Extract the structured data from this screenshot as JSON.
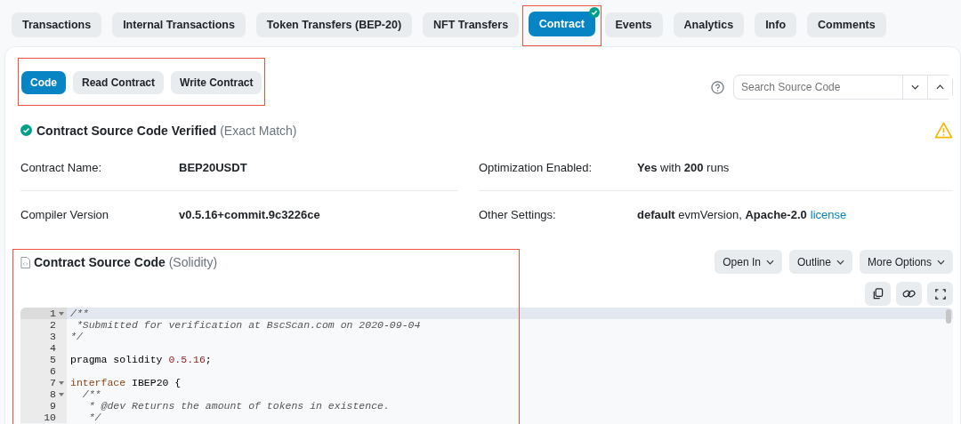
{
  "tabs": [
    {
      "label": "Transactions",
      "selected": false,
      "verified": false,
      "highlighted": false
    },
    {
      "label": "Internal Transactions",
      "selected": false,
      "verified": false,
      "highlighted": false
    },
    {
      "label": "Token Transfers (BEP-20)",
      "selected": false,
      "verified": false,
      "highlighted": false
    },
    {
      "label": "NFT Transfers",
      "selected": false,
      "verified": false,
      "highlighted": false
    },
    {
      "label": "Contract",
      "selected": true,
      "verified": true,
      "highlighted": true
    },
    {
      "label": "Events",
      "selected": false,
      "verified": false,
      "highlighted": false
    },
    {
      "label": "Analytics",
      "selected": false,
      "verified": false,
      "highlighted": false
    },
    {
      "label": "Info",
      "selected": false,
      "verified": false,
      "highlighted": false
    },
    {
      "label": "Comments",
      "selected": false,
      "verified": false,
      "highlighted": false
    }
  ],
  "subtabs": {
    "highlighted": true,
    "items": [
      {
        "label": "Code",
        "selected": true
      },
      {
        "label": "Read Contract",
        "selected": false
      },
      {
        "label": "Write Contract",
        "selected": false
      }
    ]
  },
  "search": {
    "placeholder": "Search Source Code"
  },
  "verification": {
    "title": "Contract Source Code Verified",
    "note": "(Exact Match)"
  },
  "details": [
    {
      "label": "Contract Name:",
      "value": "BEP20USDT"
    },
    {
      "label": "Optimization Enabled:",
      "value": "**Yes** with **200** runs"
    },
    {
      "label": "Compiler Version",
      "value": "v0.5.16+commit.9c3226ce"
    },
    {
      "label": "Other Settings:",
      "value": "**default** evmVersion, **Apache-2.0**",
      "link": "license"
    }
  ],
  "source": {
    "highlighted": true,
    "title": "Contract Source Code",
    "language": "(Solidity)",
    "menus": [
      "Open In",
      "Outline",
      "More Options"
    ],
    "lines": [
      {
        "number": "1",
        "fold": true,
        "active": true,
        "tokens": [
          {
            "kind": "comment",
            "text": "/**"
          }
        ]
      },
      {
        "number": "2",
        "fold": false,
        "active": false,
        "tokens": [
          {
            "kind": "comment",
            "text": " *Submitted for verification at BscScan.com on 2020-09-04"
          }
        ]
      },
      {
        "number": "3",
        "fold": false,
        "active": false,
        "tokens": [
          {
            "kind": "comment",
            "text": "*/"
          }
        ]
      },
      {
        "number": "4",
        "fold": false,
        "active": false
      },
      {
        "number": "5",
        "fold": false,
        "active": false,
        "tokens": [
          {
            "kind": "plain",
            "text": "pragma solidity "
          },
          {
            "kind": "number",
            "text": "0.5.16"
          },
          {
            "kind": "plain",
            "text": ";"
          }
        ]
      },
      {
        "number": "6",
        "fold": false,
        "active": false
      },
      {
        "number": "7",
        "fold": true,
        "active": false,
        "tokens": [
          {
            "kind": "keyword",
            "text": "interface"
          },
          {
            "kind": "plain",
            "text": " IBEP20 {"
          }
        ]
      },
      {
        "number": "8",
        "fold": true,
        "active": false,
        "tokens": [
          {
            "kind": "comment",
            "text": "  /**"
          }
        ]
      },
      {
        "number": "9",
        "fold": false,
        "active": false,
        "tokens": [
          {
            "kind": "comment",
            "text": "   * @dev Returns the amount of tokens in existence."
          }
        ]
      },
      {
        "number": "10",
        "fold": false,
        "active": false,
        "tokens": [
          {
            "kind": "comment",
            "text": "   */"
          }
        ]
      }
    ]
  }
}
